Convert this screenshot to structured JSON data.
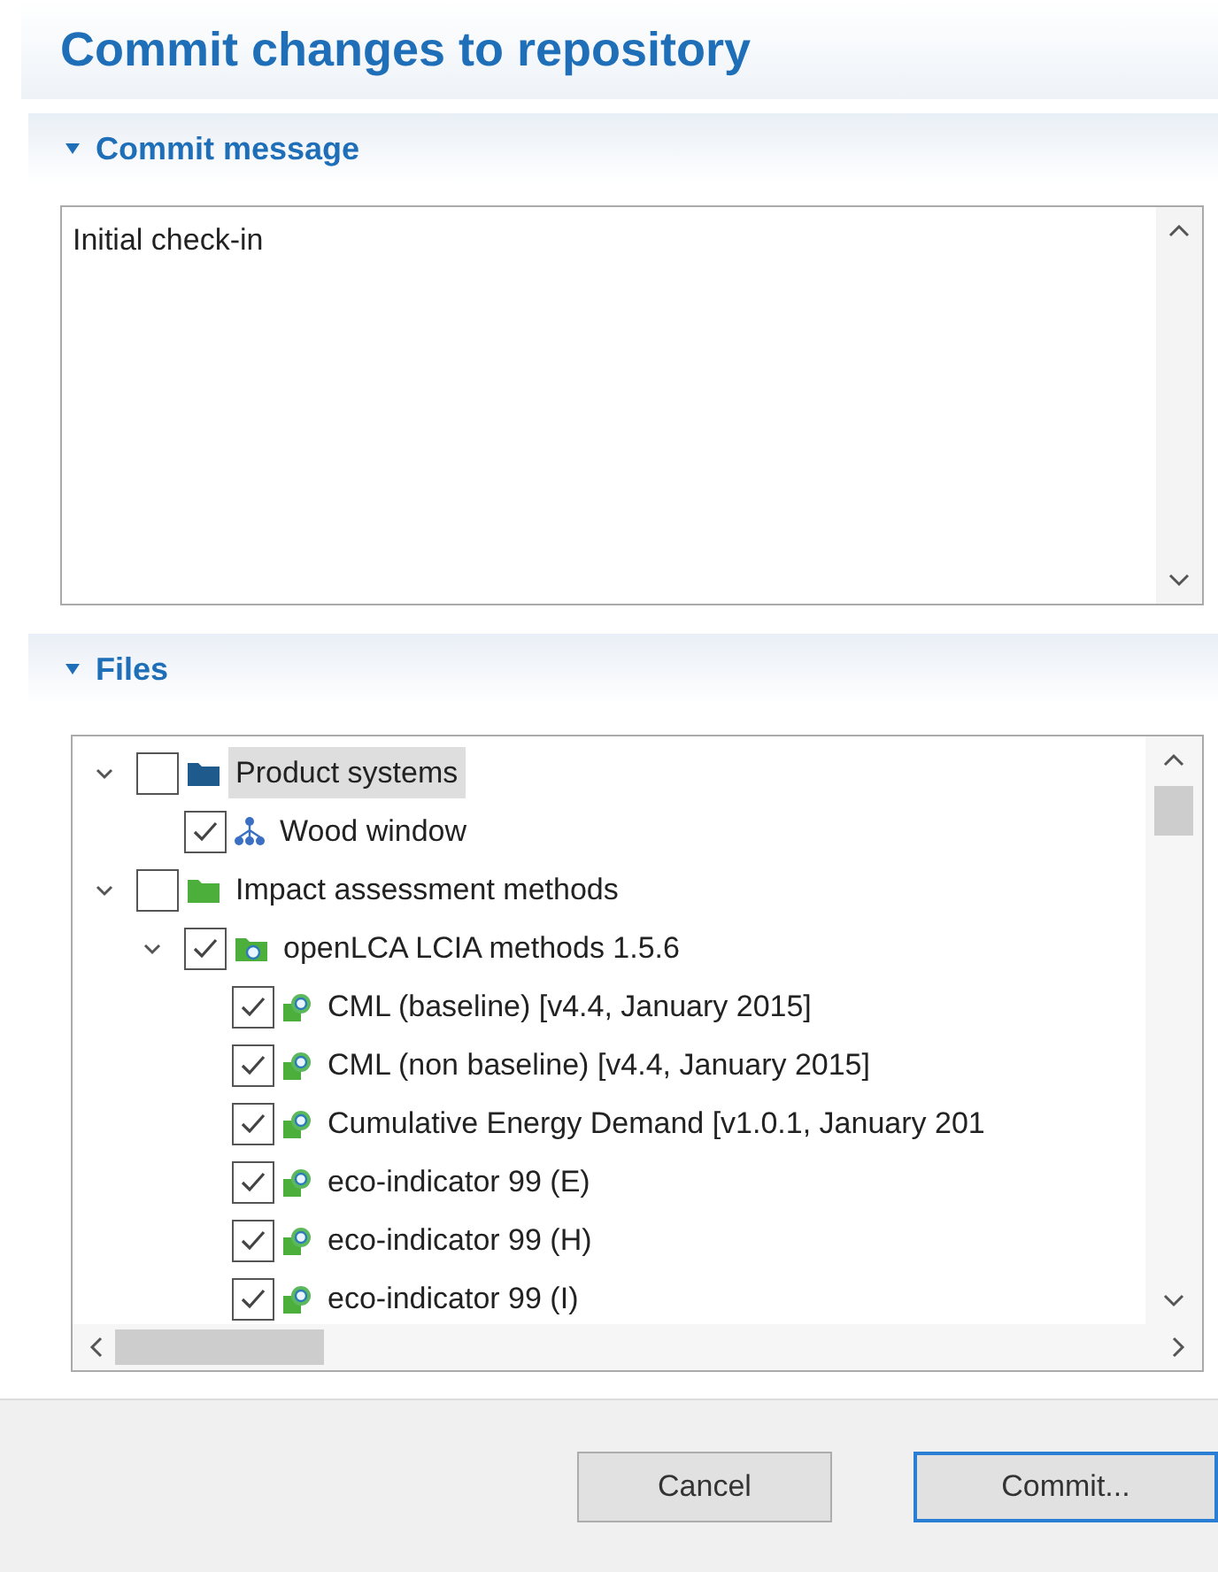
{
  "title": "Commit changes to repository",
  "message_section": {
    "title": "Commit message",
    "expanded": true,
    "value": "Initial check-in"
  },
  "files_section": {
    "title": "Files",
    "expanded": true,
    "tree": [
      {
        "label": "Product systems",
        "kind": "folder",
        "color": "#1e5a8c",
        "checked": false,
        "expanded": true,
        "selected": true,
        "children": [
          {
            "label": "Wood window",
            "kind": "product-system",
            "checked": true,
            "selected": false
          }
        ]
      },
      {
        "label": "Impact assessment methods",
        "kind": "folder",
        "color": "#4caf3c",
        "checked": false,
        "expanded": true,
        "selected": false,
        "children": [
          {
            "label": "openLCA LCIA methods 1.5.6",
            "kind": "method-group",
            "checked": true,
            "expanded": true,
            "selected": false,
            "children": [
              {
                "label": "CML (baseline) [v4.4, January 2015]",
                "kind": "method",
                "checked": true,
                "selected": false
              },
              {
                "label": "CML (non baseline) [v4.4, January 2015]",
                "kind": "method",
                "checked": true,
                "selected": false
              },
              {
                "label": "Cumulative Energy Demand [v1.0.1, January 201",
                "kind": "method",
                "checked": true,
                "selected": false
              },
              {
                "label": "eco-indicator 99 (E)",
                "kind": "method",
                "checked": true,
                "selected": false
              },
              {
                "label": "eco-indicator 99 (H)",
                "kind": "method",
                "checked": true,
                "selected": false
              },
              {
                "label": "eco-indicator 99 (I)",
                "kind": "method",
                "checked": true,
                "selected": false
              }
            ]
          }
        ]
      }
    ]
  },
  "buttons": [
    {
      "label": "Cancel",
      "default": false
    },
    {
      "label": "Commit...",
      "default": true
    }
  ]
}
